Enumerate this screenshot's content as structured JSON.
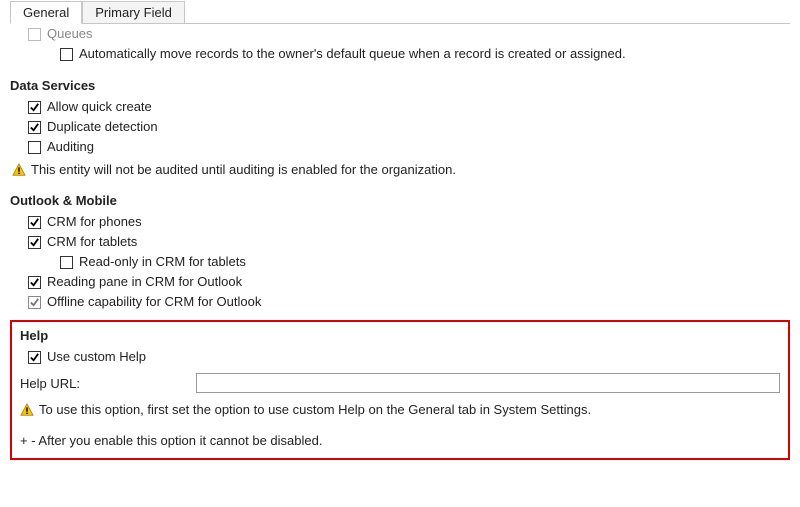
{
  "tabs": {
    "general": "General",
    "primary_field": "Primary Field"
  },
  "queues": {
    "label_partial": "Queues",
    "auto_move": {
      "label": "Automatically move records to the owner's default queue when a record is created or assigned.",
      "checked": false
    }
  },
  "data_services": {
    "header": "Data Services",
    "allow_quick_create": {
      "label": "Allow quick create",
      "checked": true
    },
    "duplicate_detection": {
      "label": "Duplicate detection",
      "checked": true
    },
    "auditing": {
      "label": "Auditing",
      "checked": false
    },
    "audit_warning": "This entity will not be audited until auditing is enabled for the organization."
  },
  "outlook_mobile": {
    "header": "Outlook & Mobile",
    "crm_phones": {
      "label": "CRM for phones",
      "checked": true
    },
    "crm_tablets": {
      "label": "CRM for tablets",
      "checked": true
    },
    "readonly_tablets": {
      "label": "Read-only in CRM for tablets",
      "checked": false
    },
    "reading_pane": {
      "label": "Reading pane in CRM for Outlook",
      "checked": true
    },
    "offline": {
      "label": "Offline capability for CRM for Outlook",
      "checked": true
    }
  },
  "help": {
    "header": "Help",
    "use_custom": {
      "label": "Use custom Help",
      "checked": true
    },
    "url_label": "Help URL:",
    "url_value": "",
    "warning": "To use this option, first set the option to use custom Help on the General tab in System Settings.",
    "footnote": "+ - After you enable this option it cannot be disabled."
  }
}
